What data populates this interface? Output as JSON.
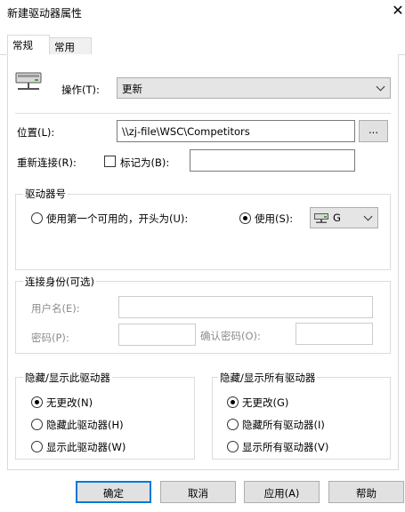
{
  "window": {
    "title": "新建驱动器属性",
    "close_glyph": "✕"
  },
  "tabs": [
    {
      "label": "常规",
      "active": true
    },
    {
      "label": "常用",
      "active": false
    }
  ],
  "general": {
    "action_label": "操作(T):",
    "action_value": "更新",
    "location_label": "位置(L):",
    "location_value": "\\\\zj-file\\WSC\\Competitors",
    "browse_label": "...",
    "reconnect_label": "重新连接(R):",
    "label_as_label": "标记为(B):",
    "label_as_value": "",
    "reconnect_checked": false
  },
  "drive_letter": {
    "legend": "驱动器号",
    "first_available_label": "使用第一个可用的，开头为(U):",
    "use_label": "使用(S):",
    "use_value": "G",
    "selected": "use"
  },
  "connect_as": {
    "legend": "连接身份(可选)",
    "username_label": "用户名(E):",
    "password_label": "密码(P):",
    "confirm_password_label": "确认密码(O):"
  },
  "hide_show_this": {
    "legend": "隐藏/显示此驱动器",
    "options": [
      "无更改(N)",
      "隐藏此驱动器(H)",
      "显示此驱动器(W)"
    ],
    "selected_index": 0
  },
  "hide_show_all": {
    "legend": "隐藏/显示所有驱动器",
    "options": [
      "无更改(G)",
      "隐藏所有驱动器(I)",
      "显示所有驱动器(V)"
    ],
    "selected_index": 0
  },
  "buttons": {
    "ok": "确定",
    "cancel": "取消",
    "apply": "应用(A)",
    "help": "帮助"
  },
  "colors": {
    "accent": "#0078d7",
    "button_face": "#e1e1e1",
    "group_border": "#dcdcdc",
    "disabled_text": "#8c8c8c"
  }
}
